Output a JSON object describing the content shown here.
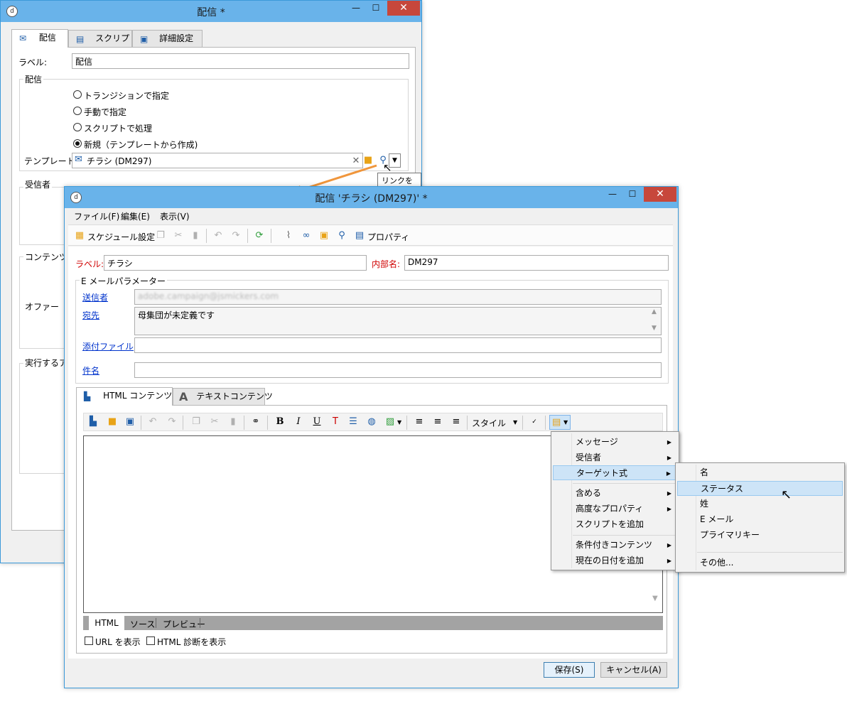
{
  "bg_window": {
    "title": "配信 *",
    "tabs": [
      "配信",
      "スクリプト",
      "詳細設定"
    ],
    "label_field": {
      "label": "ラベル:",
      "value": "配信"
    },
    "delivery_group": "配信",
    "radios": [
      {
        "label": "トランジションで指定",
        "checked": false
      },
      {
        "label": "手動で指定",
        "checked": false
      },
      {
        "label": "スクリプトで処理",
        "checked": false
      },
      {
        "label": "新規（テンプレートから作成)",
        "checked": true
      }
    ],
    "template_field": {
      "label": "テンプレート:",
      "value": "チラシ (DM297)"
    },
    "tooltip": "リンクを編集",
    "sections": [
      "受信者",
      "コンテンツ",
      "オファー",
      "実行するアク"
    ]
  },
  "fg_window": {
    "title": "配信 'チラシ (DM297)' *",
    "menubar": [
      "ファイル(F)",
      "編集(E)",
      "表示(V)"
    ],
    "toolbar": {
      "schedule": "スケジュール設定",
      "properties": "プロパティ"
    },
    "label_field": {
      "label": "ラベル:",
      "value": "チラシ"
    },
    "internal_name": {
      "label": "内部名:",
      "value": "DM297"
    },
    "email_params_group": "E メールパラメーター",
    "sender": {
      "label": "送信者",
      "value": "adobe.campaign@jsmickers.com"
    },
    "recipient": {
      "label": "宛先",
      "value": "母集団が未定義です"
    },
    "attachment": {
      "label": "添付ファイル",
      "value": ""
    },
    "subject": {
      "label": "件名",
      "value": ""
    },
    "content_tabs": [
      "HTML コンテンツ",
      "テキストコンテンツ"
    ],
    "editor_toolbar": {
      "style_label": "スタイル"
    },
    "editor_tabs": [
      "HTML",
      "ソース",
      "プレビュー"
    ],
    "checkboxes": [
      "URL を表示",
      "HTML 診断を表示"
    ],
    "buttons": {
      "save": "保存(S)",
      "cancel": "キャンセル(A)"
    }
  },
  "context_menu": {
    "items": [
      "メッセージ",
      "受信者",
      "ターゲット式",
      "含める",
      "高度なプロパティ",
      "スクリプトを追加",
      "条件付きコンテンツ",
      "現在の日付を追加"
    ],
    "highlighted": "ターゲット式"
  },
  "submenu": {
    "items": [
      "名",
      "ステータス",
      "姓",
      "E メール",
      "プライマリキー",
      "その他..."
    ],
    "highlighted": "ステータス"
  },
  "colors": {
    "titlebar": "#69b3ea",
    "close": "#c7473b",
    "accent_arrow": "#f0963c",
    "required_label": "#d00000"
  }
}
